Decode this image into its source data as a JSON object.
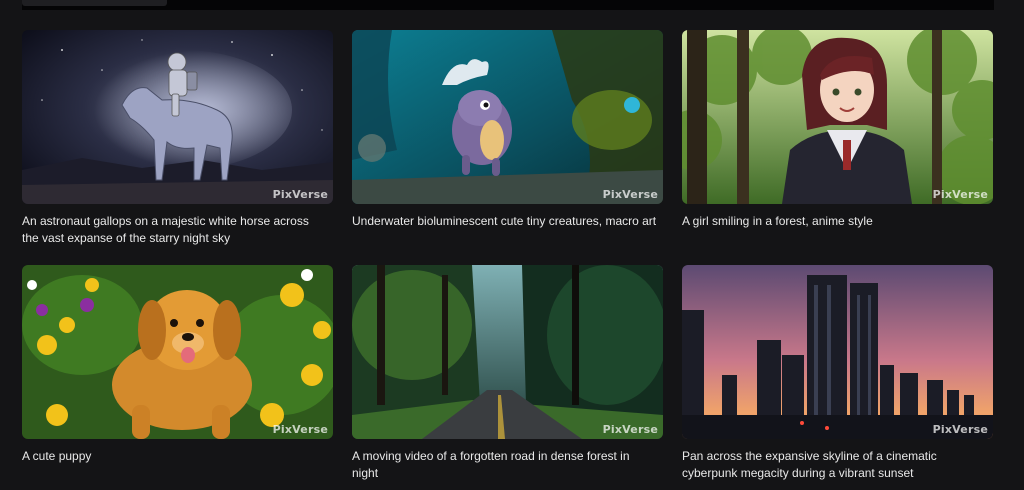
{
  "watermark": "PixVerse",
  "cards": [
    {
      "caption": "An astronaut gallops on a majestic white horse across the vast expanse of the starry night sky"
    },
    {
      "caption": "Underwater bioluminescent cute tiny creatures, macro art"
    },
    {
      "caption": "A girl smiling in a forest, anime style"
    },
    {
      "caption": "A cute puppy"
    },
    {
      "caption": "A moving video of a forgotten road in dense forest in night"
    },
    {
      "caption": "Pan across the expansive skyline of a cinematic cyberpunk megacity during a vibrant sunset"
    }
  ]
}
